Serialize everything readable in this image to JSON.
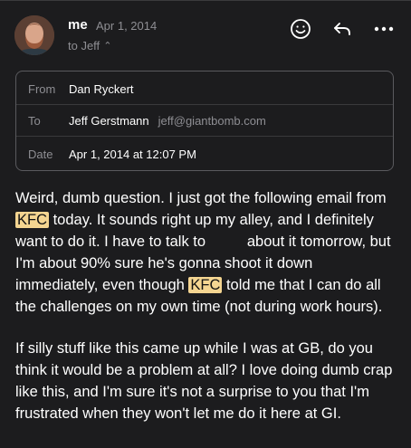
{
  "message": {
    "sender": "me",
    "date": "Apr 1, 2014",
    "to_summary": "to Jeff"
  },
  "details": {
    "from_label": "From",
    "from_value": "Dan Ryckert",
    "to_label": "To",
    "to_name": "Jeff Gerstmann",
    "to_email": "jeff@giantbomb.com",
    "date_label": "Date",
    "date_value": "Apr 1, 2014 at 12:07 PM"
  },
  "body": {
    "p1_a": "Weird, dumb question. I just got the following email from ",
    "kfc1": "KFC",
    "p1_b": " today. It sounds right up my alley, and I definitely want to do it. I have to talk to          about it tomorrow, but I'm about 90% sure he's gonna shoot it down immediately, even though ",
    "kfc2": "KFC",
    "p1_c": " told me that I can do all the challenges on my own time (not during work hours).",
    "p2": "If silly stuff like this came up while I was at GB, do you think it would be a problem at all? I love doing dumb crap like this, and I'm sure it's not a surprise to you that I'm frustrated when they won't let me do it here at GI."
  },
  "icons": {
    "reaction": "smiley-icon",
    "reply": "reply-icon",
    "more": "more-icon"
  },
  "colors": {
    "background": "#1c1c1e",
    "highlight": "#f4d591",
    "secondary_text": "#8e8e93"
  }
}
